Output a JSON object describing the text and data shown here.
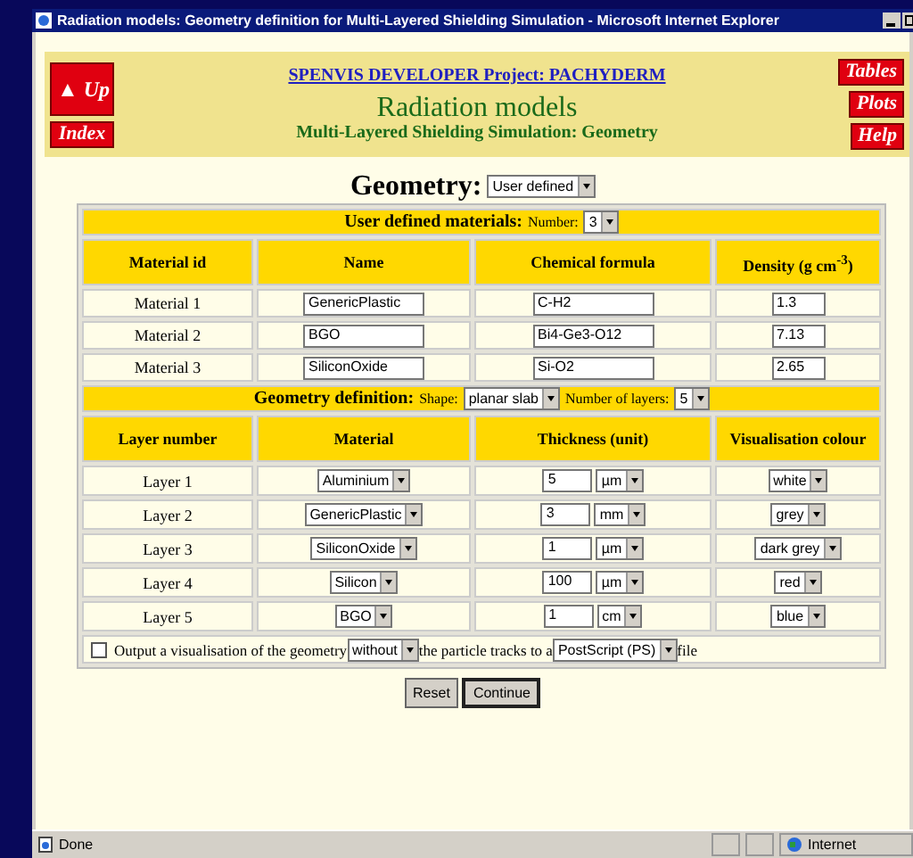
{
  "window": {
    "title": "Radiation models: Geometry definition for Multi-Layered Shielding Simulation - Microsoft Internet Explorer"
  },
  "header": {
    "up": "Up",
    "up_arrow": "▲",
    "index": "Index",
    "project_link": "SPENVIS DEVELOPER Project: PACHYDERM",
    "title": "Radiation models",
    "subtitle": "Multi-Layered Shielding Simulation: Geometry",
    "side_buttons": [
      "Tables",
      "Plots",
      "Help"
    ]
  },
  "geometry": {
    "label": "Geometry:",
    "value": "User defined"
  },
  "materials": {
    "label": "User defined materials:",
    "number_label": "Number:",
    "number": "3",
    "columns": [
      "Material id",
      "Name",
      "Chemical formula",
      "Density (g cm$^{-3}$)"
    ],
    "rows": [
      {
        "id": "Material 1",
        "name": "GenericPlastic",
        "formula": "C-H2",
        "density": "1.3"
      },
      {
        "id": "Material 2",
        "name": "BGO",
        "formula": "Bi4-Ge3-O12",
        "density": "7.13"
      },
      {
        "id": "Material 3",
        "name": "SiliconOxide",
        "formula": "Si-O2",
        "density": "2.65"
      }
    ]
  },
  "geometry_definition": {
    "label": "Geometry definition:",
    "shape_label": "Shape:",
    "shape": "planar slab",
    "layers_label": "Number of layers:",
    "layers": "5",
    "columns": [
      "Layer number",
      "Material",
      "Thickness (unit)",
      "Visualisation colour"
    ],
    "rows": [
      {
        "layer": "Layer 1",
        "material": "Aluminium",
        "thickness": "5",
        "unit": "µm",
        "colour": "white"
      },
      {
        "layer": "Layer 2",
        "material": "GenericPlastic",
        "thickness": "3",
        "unit": "mm",
        "colour": "grey"
      },
      {
        "layer": "Layer 3",
        "material": "SiliconOxide",
        "thickness": "1",
        "unit": "µm",
        "colour": "dark grey"
      },
      {
        "layer": "Layer 4",
        "material": "Silicon",
        "thickness": "100",
        "unit": "µm",
        "colour": "red"
      },
      {
        "layer": "Layer 5",
        "material": "BGO",
        "thickness": "1",
        "unit": "cm",
        "colour": "blue"
      }
    ]
  },
  "output": {
    "checked": false,
    "text_before": "Output a visualisation of the geometry",
    "tracks": "without",
    "text_middle": "the particle tracks to a",
    "format": "PostScript (PS)",
    "text_after": "file"
  },
  "buttons": [
    "Reset",
    "Continue"
  ],
  "status_bar": {
    "text": "Done",
    "zone": "Internet"
  }
}
